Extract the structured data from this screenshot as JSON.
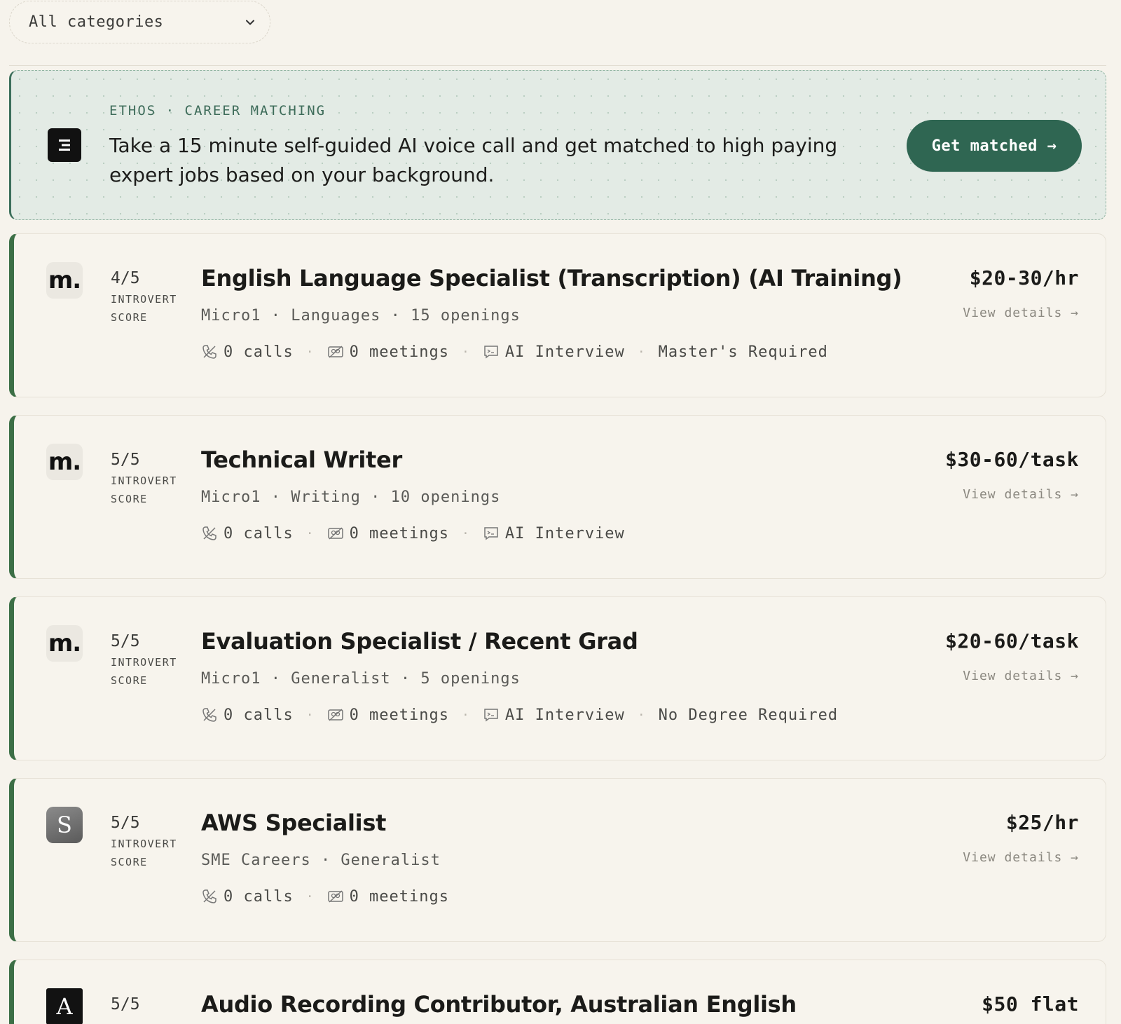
{
  "filter": {
    "category_label": "All categories"
  },
  "banner": {
    "kicker": "ETHOS · CAREER MATCHING",
    "text": "Take a 15 minute self-guided AI voice call and get matched to high paying expert jobs based on your background.",
    "cta": "Get matched →"
  },
  "jobs": [
    {
      "logo_letter": "m.",
      "score": "4/5",
      "score_label": "INTROVERT SCORE",
      "title": "English Language Specialist (Transcription) (AI Training)",
      "meta": "Micro1 · Languages · 15 openings",
      "calls": "0 calls",
      "meetings": "0 meetings",
      "interview": "AI Interview",
      "requirement": "Master's Required",
      "pay": "$20-30/hr",
      "details": "View details →"
    },
    {
      "logo_letter": "m.",
      "score": "5/5",
      "score_label": "INTROVERT SCORE",
      "title": "Technical Writer",
      "meta": "Micro1 · Writing · 10 openings",
      "calls": "0 calls",
      "meetings": "0 meetings",
      "interview": "AI Interview",
      "pay": "$30-60/task",
      "details": "View details →"
    },
    {
      "logo_letter": "m.",
      "score": "5/5",
      "score_label": "INTROVERT SCORE",
      "title": "Evaluation Specialist / Recent Grad",
      "meta": "Micro1 · Generalist · 5 openings",
      "calls": "0 calls",
      "meetings": "0 meetings",
      "interview": "AI Interview",
      "requirement": "No Degree Required",
      "pay": "$20-60/task",
      "details": "View details →"
    },
    {
      "logo_letter": "S",
      "score": "5/5",
      "score_label": "INTROVERT SCORE",
      "title": "AWS Specialist",
      "meta": "SME Careers · Generalist",
      "calls": "0 calls",
      "meetings": "0 meetings",
      "pay": "$25/hr",
      "details": "View details →"
    },
    {
      "logo_letter": "A",
      "score": "5/5",
      "title": "Audio Recording Contributor, Australian English",
      "pay": "$50 flat"
    }
  ],
  "colors": {
    "background": "#f6f3ec",
    "accent_green": "#3c6f46",
    "button_green": "#2f6652",
    "banner_bg": "#e3ebe5"
  },
  "icons": {
    "filter": "chevron-down-icon",
    "banner": "ethos-logo-icon",
    "calls": "phone-icon",
    "meetings": "meeting-icon",
    "interview": "chat-terminal-icon"
  }
}
